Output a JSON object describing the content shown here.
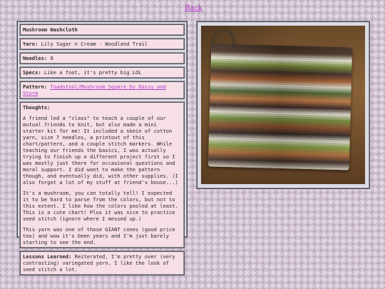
{
  "nav": {
    "back": "Back"
  },
  "project": {
    "title": "Mushroom Washcloth",
    "yarn_label": "Yarn:",
    "yarn": "Lily Sugar n Cream - Woodland Trail",
    "needles_label": "Needles:",
    "needles": "8",
    "specs_label": "Specs:",
    "specs": "Like a foot, it's pretty big LOL",
    "pattern_label": "Pattern:",
    "pattern": "Toadstool/Mushroom Square by Daisy and Storm",
    "thoughts_label": "Thoughts:",
    "thoughts": [
      "A friend led a \"class\" to teach a couple of our mutual friends to knit, but also made a mini starter kit for me! It included a skein of cotton yarn, size 7 needles, a printout of this chart/pattern, and a couple stitch markers. While teaching our friends the basics, I was actually trying to finish up a different project first so I was mostly just there for occasional questions and moral support. I did want to make the pattern though, and eventually did, with other supplies. (I also forgot a lot of my stuff at friend's house...)",
      "It's a mushroom, you can totally tell! I expected it to be hard to parse from the colors, but not to this extent. I like how the colors pooled at least. This is a cute chart! Plus it was nice to practice seed stitch (ignore where I messed up.)",
      "This yarn was one of those GIANT cones (good price too) and wow it's been years and I'm just barely starting to see the end."
    ],
    "lessons_label": "Lessons Learned:",
    "lessons": "Reiterated, I'm pretty over (very contrasting) variegated yarn. I like the look of seed stitch a lot."
  },
  "photo": {
    "icon": "knitted-washcloth-photo"
  }
}
